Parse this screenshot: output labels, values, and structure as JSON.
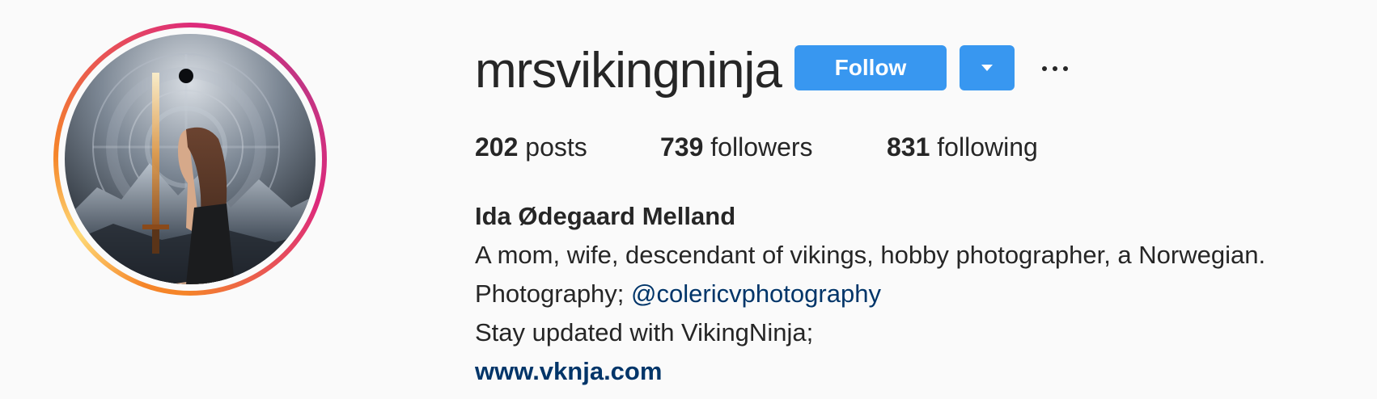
{
  "profile": {
    "username": "mrsvikingninja",
    "follow_label": "Follow",
    "dropdown_icon": "caret-down-icon",
    "more_icon": "ellipsis-icon"
  },
  "stats": {
    "posts_count": "202",
    "posts_label": "posts",
    "followers_count": "739",
    "followers_label": "followers",
    "following_count": "831",
    "following_label": "following"
  },
  "bio": {
    "full_name": "Ida Ødegaard Melland",
    "line1": "A mom, wife, descendant of vikings, hobby photographer, a Norwegian.",
    "line2_prefix": "Photography; ",
    "line2_mention": "@colericvphotography",
    "line3": "Stay updated with VikingNinja;",
    "website": "www.vknja.com"
  },
  "colors": {
    "accent": "#3897f0",
    "link": "#003569",
    "text": "#262626",
    "background": "#fafafa"
  }
}
